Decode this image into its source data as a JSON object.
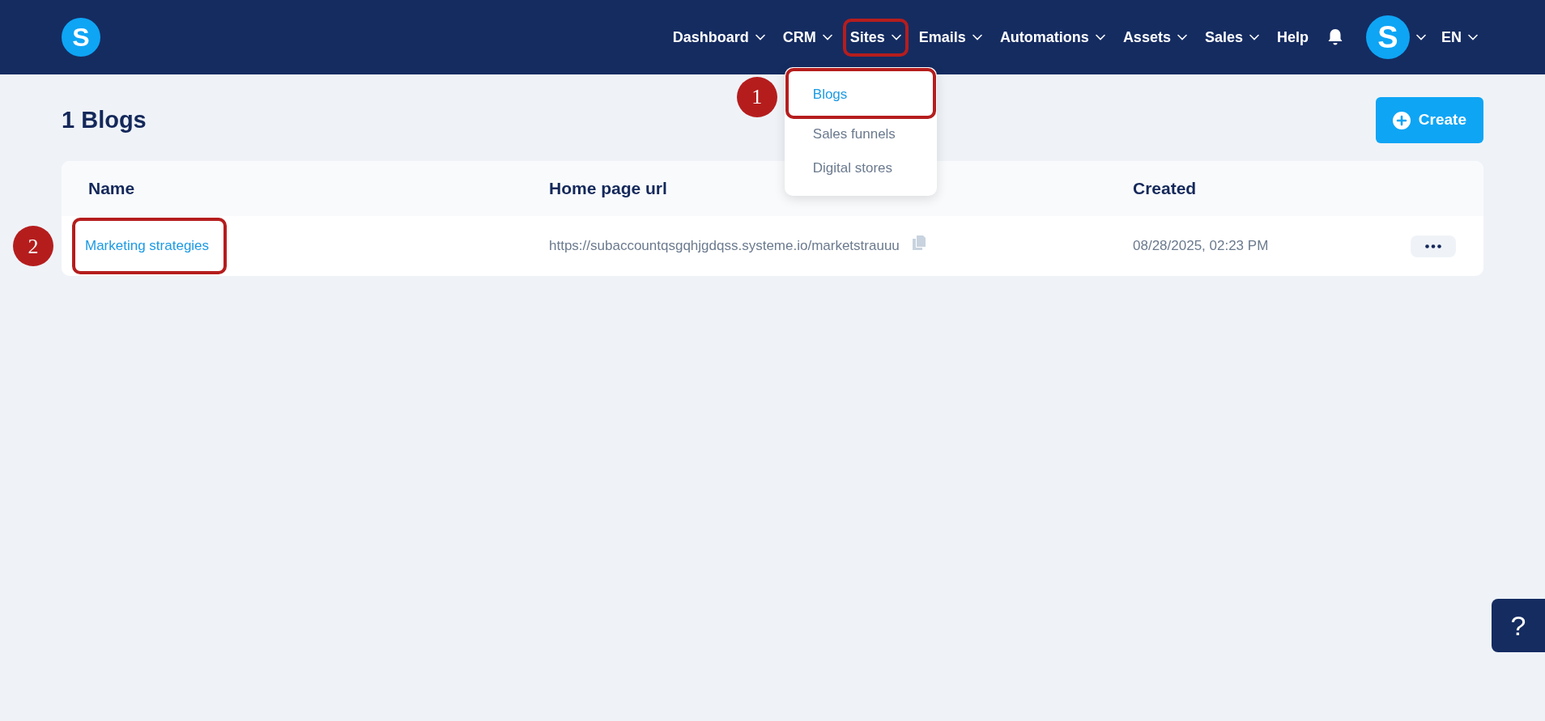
{
  "logo": {
    "text": "S"
  },
  "nav": [
    {
      "label": "Dashboard",
      "kind": "dropdown",
      "highlighted": false
    },
    {
      "label": "CRM",
      "kind": "dropdown",
      "highlighted": false
    },
    {
      "label": "Sites",
      "kind": "dropdown",
      "highlighted": true,
      "menu": [
        {
          "label": "Blogs",
          "selected": true,
          "highlighted": true,
          "marker": "1"
        },
        {
          "label": "Sales funnels",
          "selected": false,
          "highlighted": false
        },
        {
          "label": "Digital stores",
          "selected": false,
          "highlighted": false
        }
      ]
    },
    {
      "label": "Emails",
      "kind": "dropdown",
      "highlighted": false
    },
    {
      "label": "Automations",
      "kind": "dropdown",
      "highlighted": false
    },
    {
      "label": "Assets",
      "kind": "dropdown",
      "highlighted": false
    },
    {
      "label": "Sales",
      "kind": "dropdown",
      "highlighted": false
    },
    {
      "label": "Help",
      "kind": "link",
      "highlighted": false
    }
  ],
  "avatar": {
    "text": "S"
  },
  "language": {
    "label": "EN"
  },
  "page_title": "1 Blogs",
  "create_button": "Create",
  "table": {
    "columns": [
      "Name",
      "Home page url",
      "Created"
    ],
    "rows": [
      {
        "name": "Marketing strategies",
        "name_highlighted": true,
        "marker": "2",
        "url": "https://subaccountqsgqhjgdqss.systeme.io/marketstrauuu",
        "created": "08/28/2025, 02:23 PM"
      }
    ]
  },
  "help_button": "?"
}
